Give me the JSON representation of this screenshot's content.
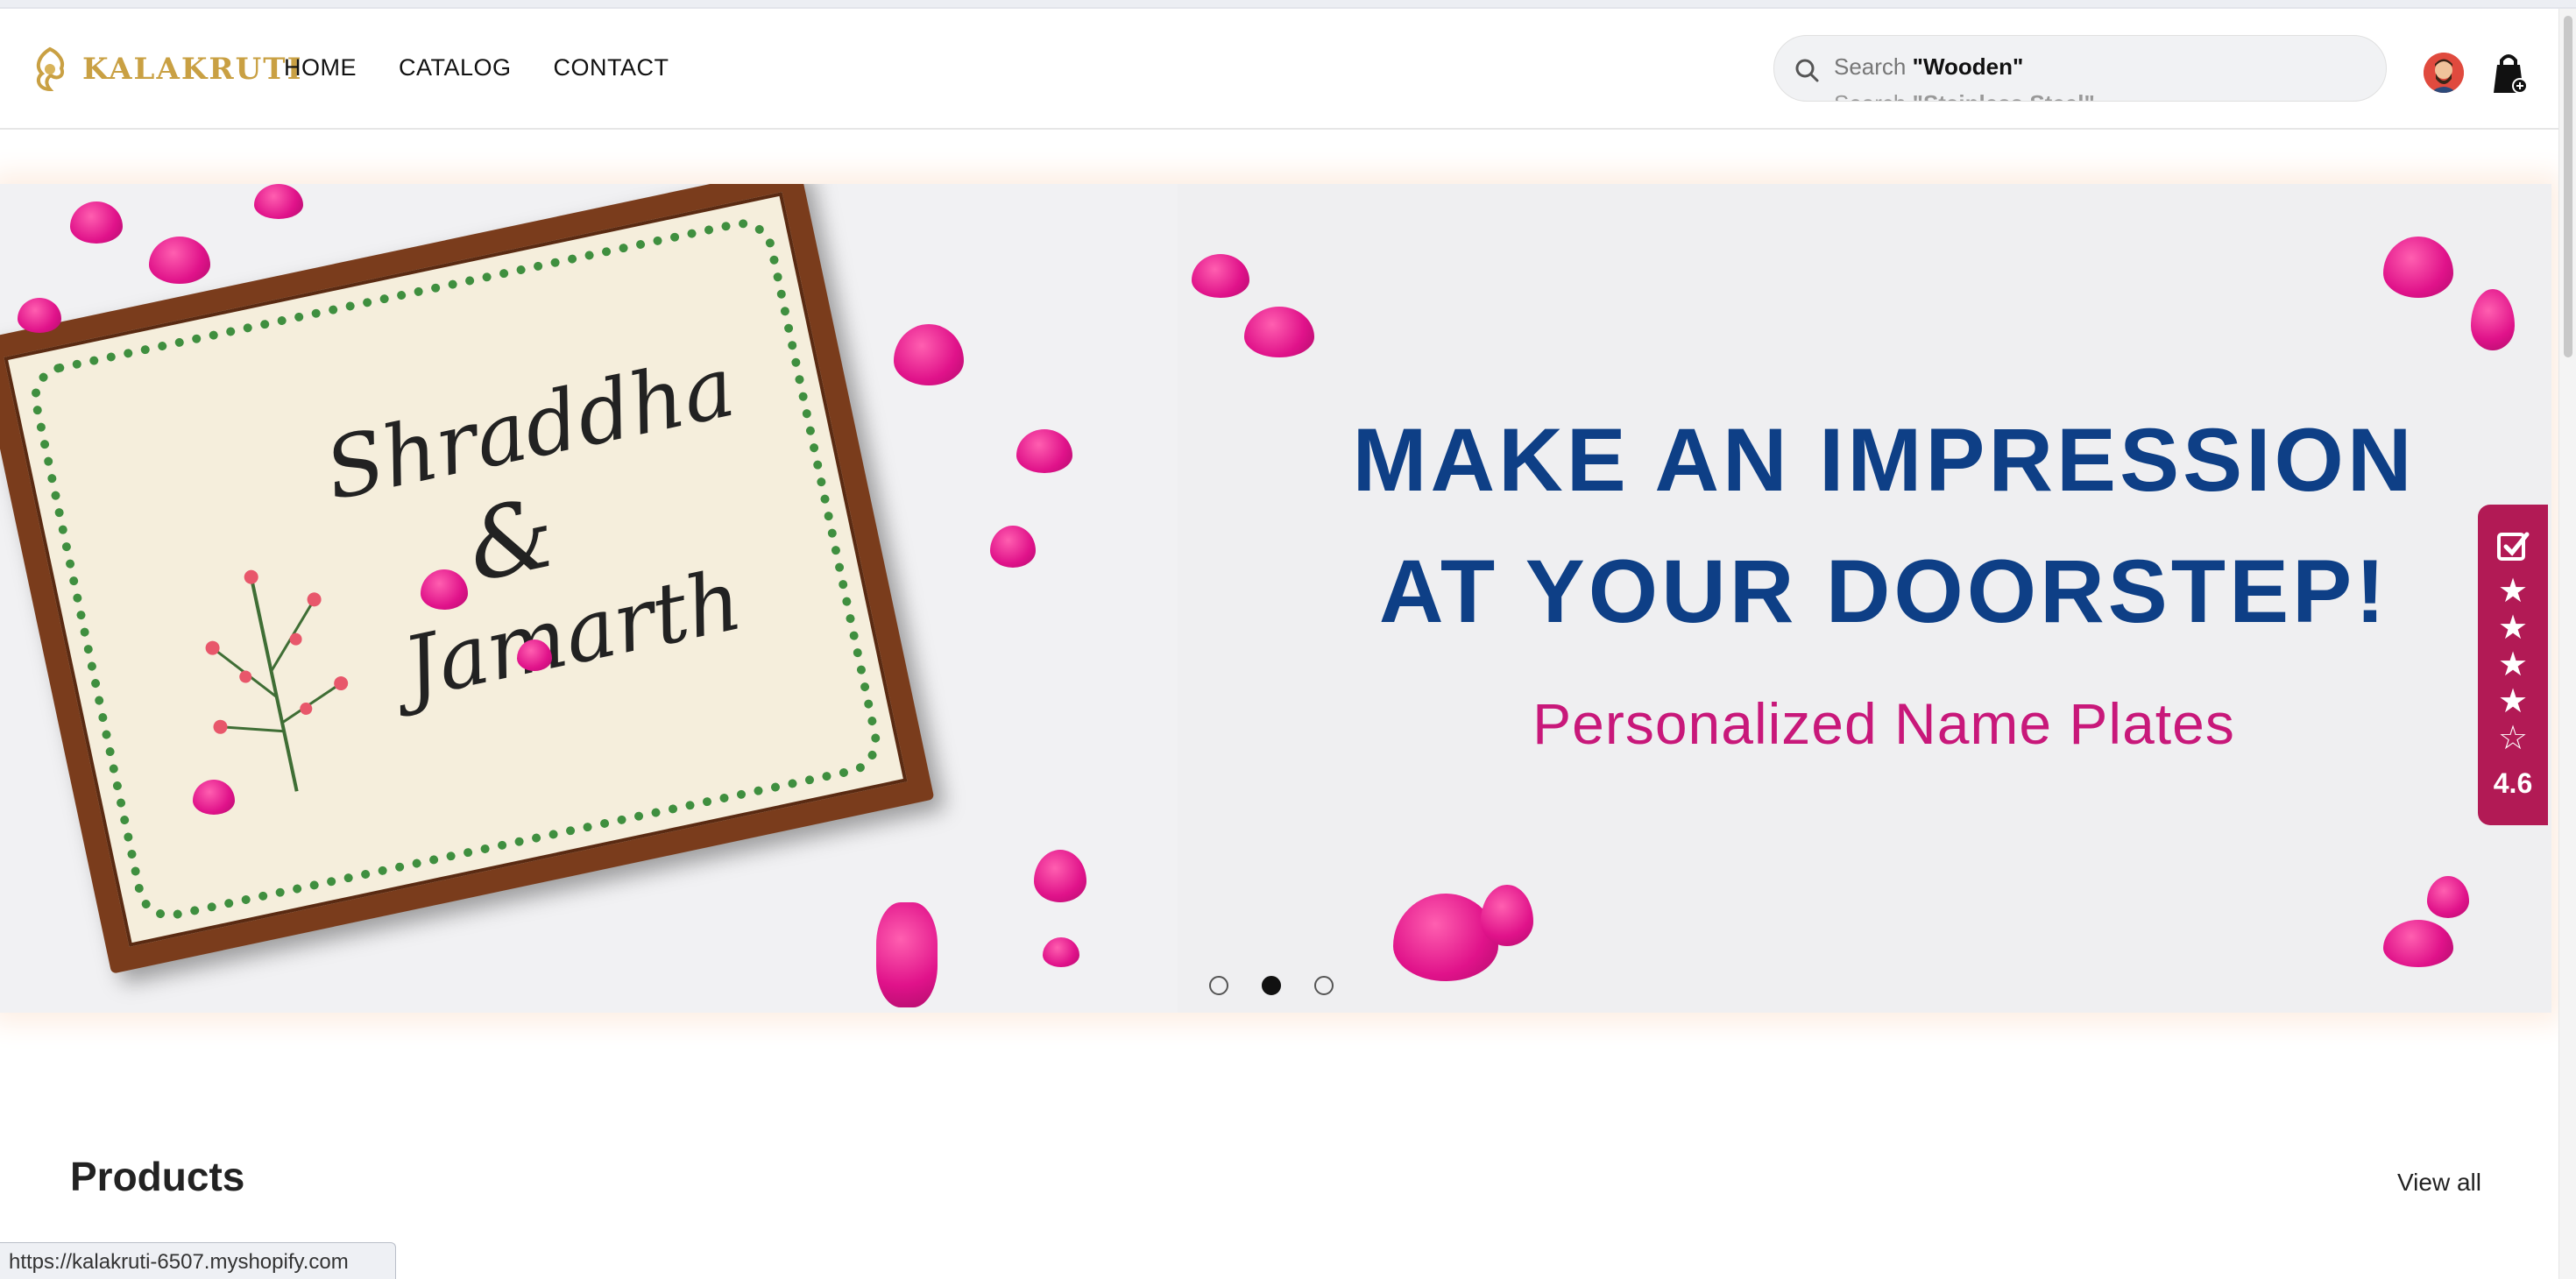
{
  "brand": {
    "name": "KALAKRUTI",
    "accent": "#c9a043"
  },
  "nav": {
    "items": [
      {
        "label": "HOME"
      },
      {
        "label": "CATALOG"
      },
      {
        "label": "CONTACT"
      }
    ]
  },
  "search": {
    "prefix": "Search",
    "term": "\"Wooden\"",
    "next_prefix": "Search",
    "next_term": "\"Stainless Steel\"",
    "icon": "search-icon"
  },
  "header_icons": {
    "avatar": "avatar",
    "cart": "shopping-bag-icon"
  },
  "hero": {
    "plate_names": {
      "first": "Shraddha",
      "amp": "&",
      "second": "Jamarth"
    },
    "headline_line1": "MAKE AN IMPRESSION",
    "headline_line2": "AT YOUR DOORSTEP!",
    "subline": "Personalized Name Plates",
    "headline_color": "#0e3f86",
    "subline_color": "#c8187a",
    "slides_total": 3,
    "active_slide": 2
  },
  "reviews": {
    "score": "4.6",
    "stars": "★★★★☆",
    "color": "#b21a55"
  },
  "products": {
    "title": "Products",
    "view_all": "View all"
  },
  "status_url": "https://kalakruti-6507.myshopify.com"
}
